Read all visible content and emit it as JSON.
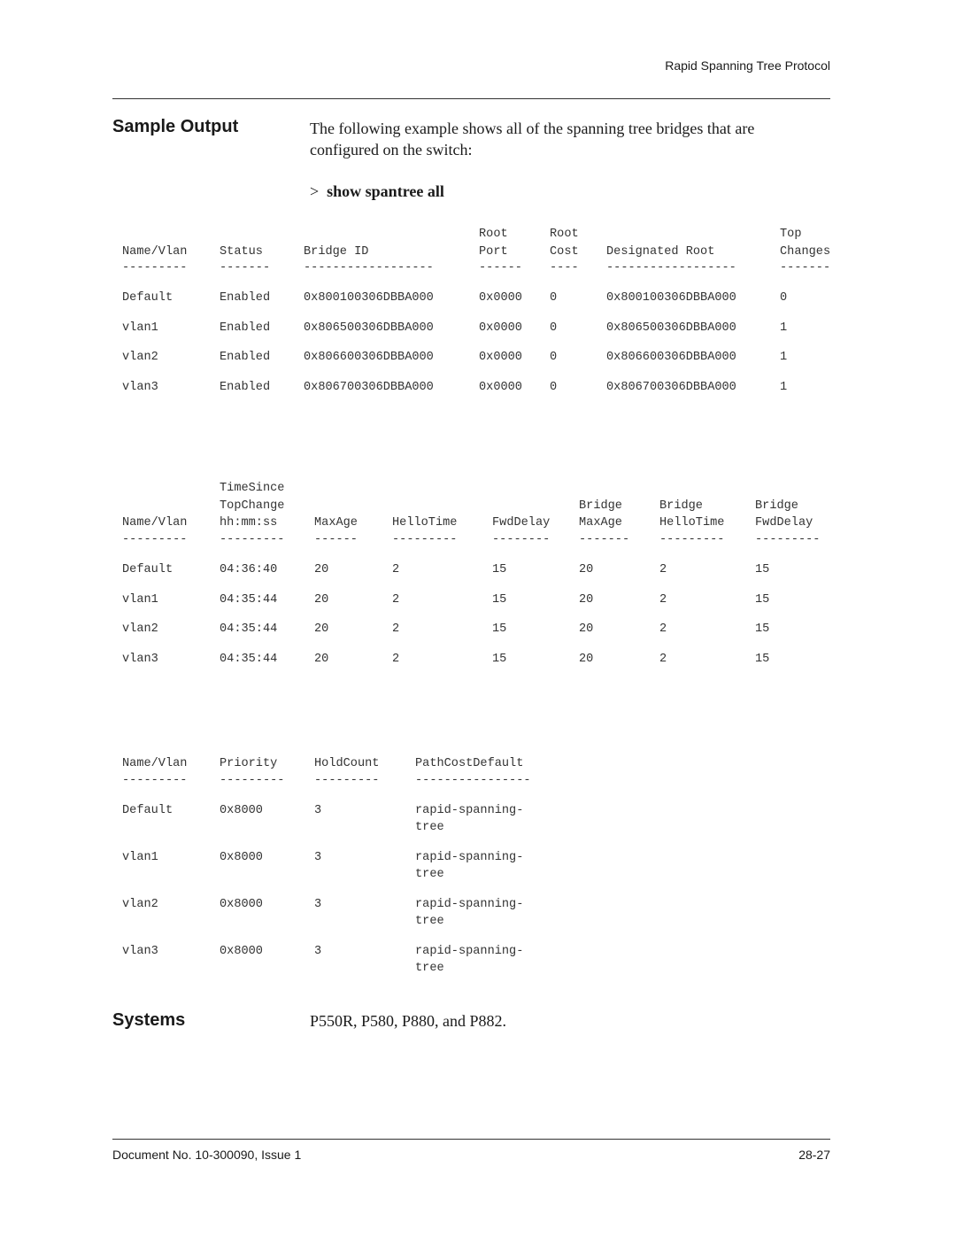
{
  "header": {
    "running_title": "Rapid Spanning Tree Protocol"
  },
  "sample_output": {
    "heading": "Sample Output",
    "description": "The following example shows all of the spanning tree bridges that are configured on the switch:",
    "prompt": ">",
    "command": "show spantree all"
  },
  "table1": {
    "columns": [
      {
        "lines": [
          "",
          "Name/Vlan"
        ],
        "dashes": "---------"
      },
      {
        "lines": [
          "",
          "Status"
        ],
        "dashes": "-------"
      },
      {
        "lines": [
          "",
          "Bridge ID"
        ],
        "dashes": "------------------"
      },
      {
        "lines": [
          "Root",
          "Port"
        ],
        "dashes": "------"
      },
      {
        "lines": [
          "Root",
          "Cost"
        ],
        "dashes": "----"
      },
      {
        "lines": [
          "",
          "Designated Root"
        ],
        "dashes": "------------------"
      },
      {
        "lines": [
          "Top",
          "Changes"
        ],
        "dashes": "-------"
      }
    ],
    "rows": [
      [
        "Default",
        "Enabled",
        "0x800100306DBBA000",
        "0x0000",
        "0",
        "0x800100306DBBA000",
        "0"
      ],
      [
        "vlan1",
        "Enabled",
        "0x806500306DBBA000",
        "0x0000",
        "0",
        "0x806500306DBBA000",
        "1"
      ],
      [
        "vlan2",
        "Enabled",
        "0x806600306DBBA000",
        "0x0000",
        "0",
        "0x806600306DBBA000",
        "1"
      ],
      [
        "vlan3",
        "Enabled",
        "0x806700306DBBA000",
        "0x0000",
        "0",
        "0x806700306DBBA000",
        "1"
      ]
    ]
  },
  "table2": {
    "columns": [
      {
        "lines": [
          "",
          "",
          "Name/Vlan"
        ],
        "dashes": "---------"
      },
      {
        "lines": [
          "TimeSince",
          "TopChange",
          "hh:mm:ss"
        ],
        "dashes": "---------"
      },
      {
        "lines": [
          "",
          "",
          "MaxAge"
        ],
        "dashes": "------"
      },
      {
        "lines": [
          "",
          "",
          "HelloTime"
        ],
        "dashes": "---------"
      },
      {
        "lines": [
          "",
          "",
          "FwdDelay"
        ],
        "dashes": "--------"
      },
      {
        "lines": [
          "",
          "Bridge",
          "MaxAge"
        ],
        "dashes": "-------"
      },
      {
        "lines": [
          "",
          "Bridge",
          "HelloTime"
        ],
        "dashes": "---------"
      },
      {
        "lines": [
          "",
          "Bridge",
          "FwdDelay"
        ],
        "dashes": "---------"
      }
    ],
    "rows": [
      [
        "Default",
        "04:36:40",
        "20",
        "2",
        "15",
        "20",
        "2",
        "15"
      ],
      [
        "vlan1",
        "04:35:44",
        "20",
        "2",
        "15",
        "20",
        "2",
        "15"
      ],
      [
        "vlan2",
        "04:35:44",
        "20",
        "2",
        "15",
        "20",
        "2",
        "15"
      ],
      [
        "vlan3",
        "04:35:44",
        "20",
        "2",
        "15",
        "20",
        "2",
        "15"
      ]
    ]
  },
  "table3": {
    "columns": [
      {
        "lines": [
          "Name/Vlan"
        ],
        "dashes": "---------"
      },
      {
        "lines": [
          "Priority"
        ],
        "dashes": "---------"
      },
      {
        "lines": [
          "HoldCount"
        ],
        "dashes": "---------"
      },
      {
        "lines": [
          "PathCostDefault"
        ],
        "dashes": "----------------"
      }
    ],
    "rows": [
      [
        "Default",
        "0x8000",
        "3",
        "rapid-spanning-\ntree"
      ],
      [
        "vlan1",
        "0x8000",
        "3",
        "rapid-spanning-\ntree"
      ],
      [
        "vlan2",
        "0x8000",
        "3",
        "rapid-spanning-\ntree"
      ],
      [
        "vlan3",
        "0x8000",
        "3",
        "rapid-spanning-\ntree"
      ]
    ]
  },
  "systems": {
    "heading": "Systems",
    "text": "P550R, P580, P880, and P882."
  },
  "footer": {
    "document": "Document No. 10-300090, Issue 1",
    "page": "28-27"
  }
}
